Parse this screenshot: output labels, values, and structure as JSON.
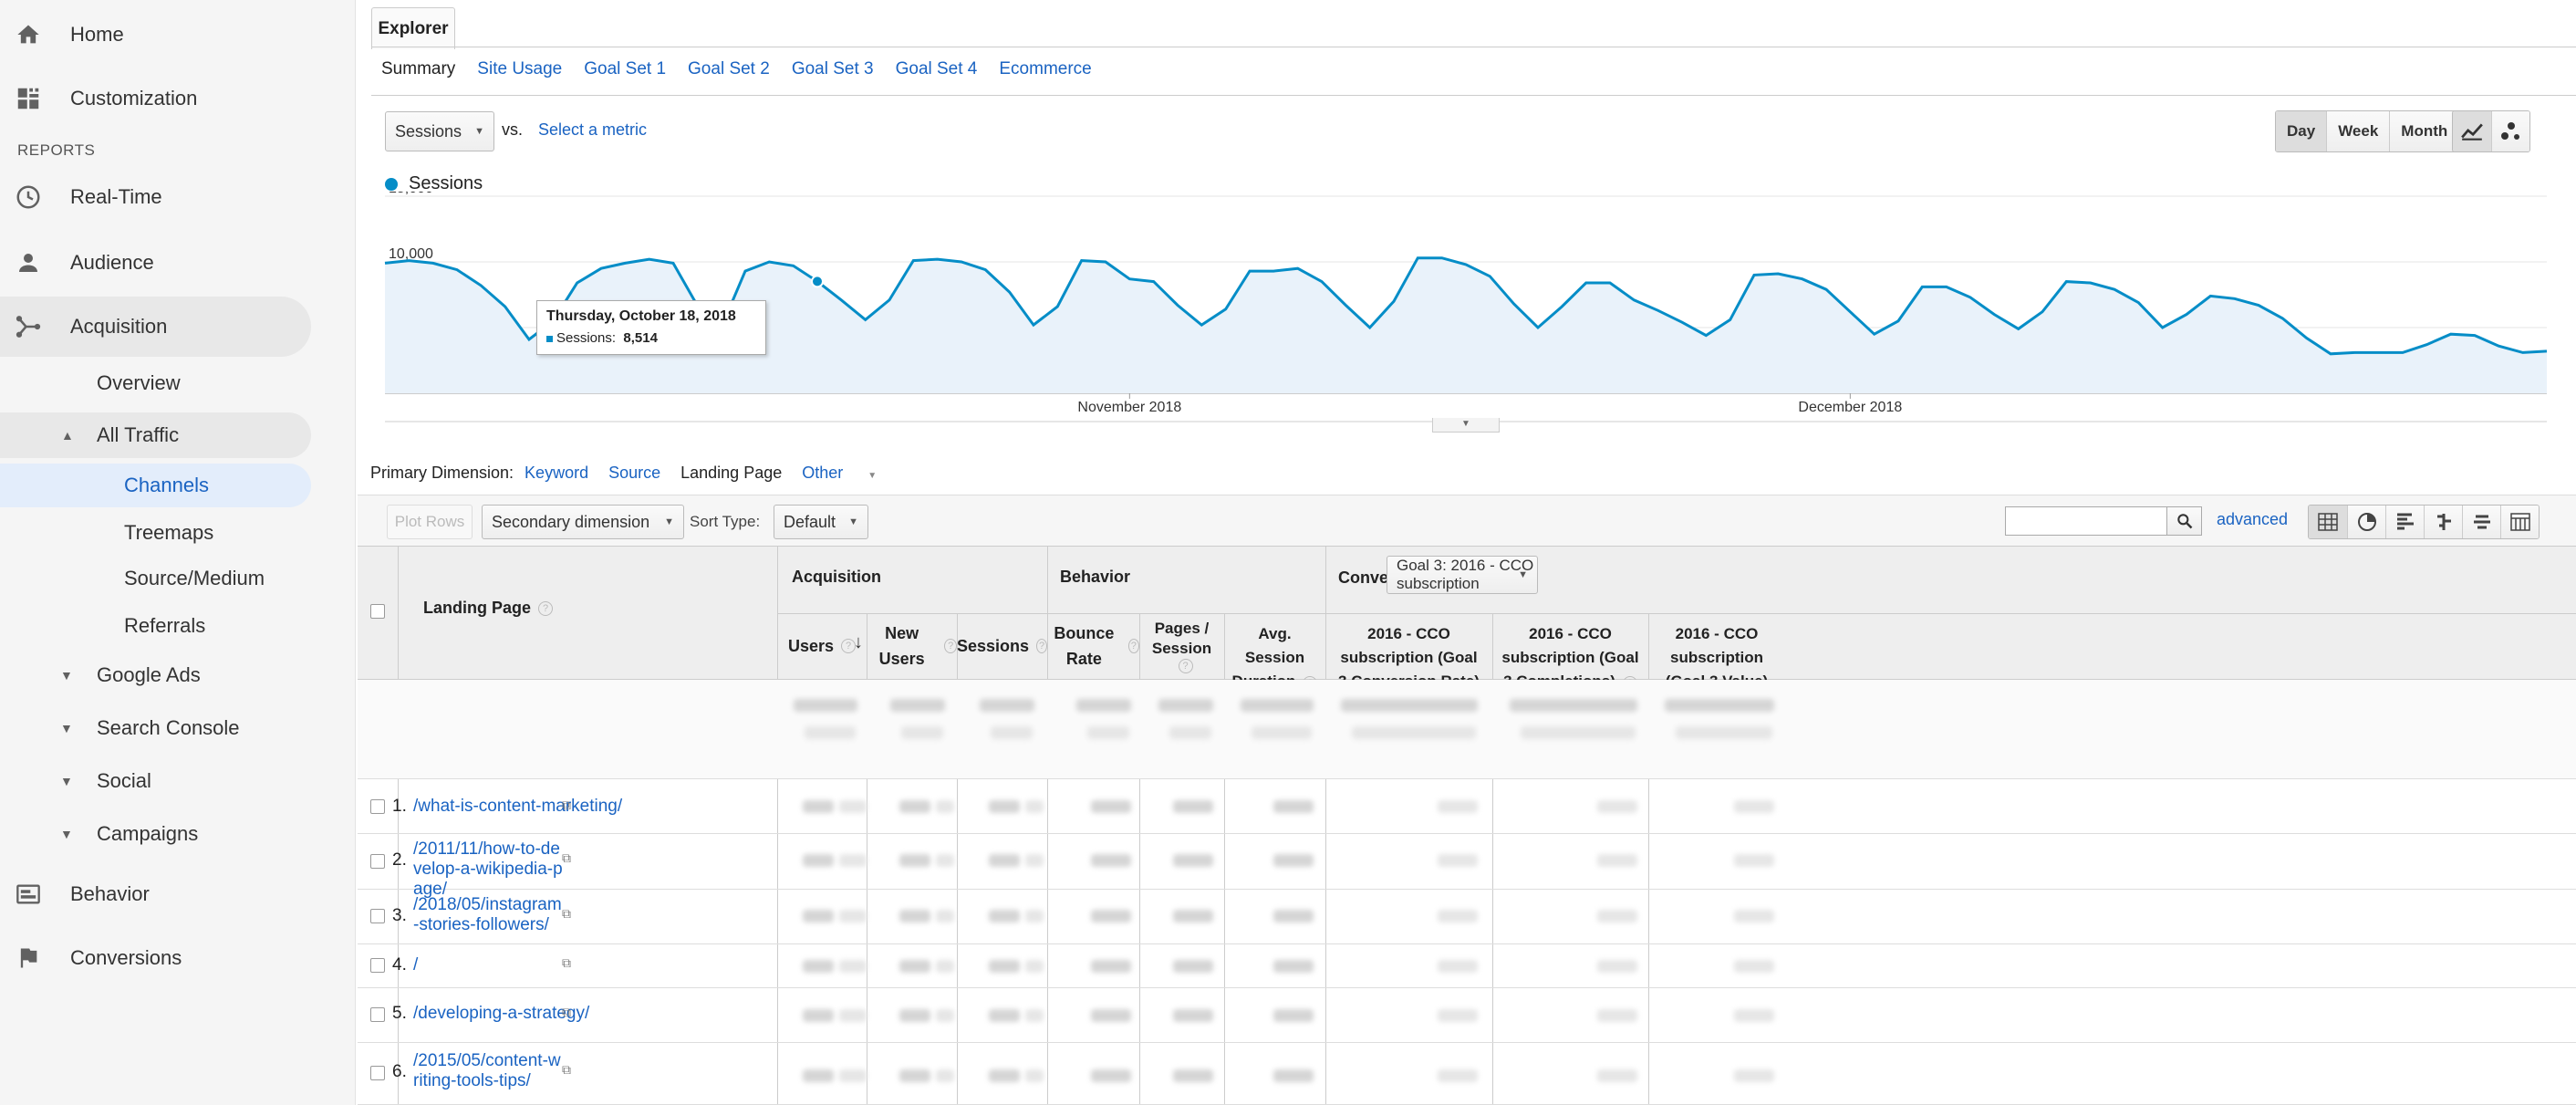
{
  "sidebar": {
    "home": "Home",
    "customization": "Customization",
    "reports_label": "REPORTS",
    "realtime": "Real-Time",
    "audience": "Audience",
    "acquisition": "Acquisition",
    "overview": "Overview",
    "all_traffic": "All Traffic",
    "channels": "Channels",
    "treemaps": "Treemaps",
    "source_medium": "Source/Medium",
    "referrals": "Referrals",
    "google_ads": "Google Ads",
    "search_console": "Search Console",
    "social": "Social",
    "campaigns": "Campaigns",
    "behavior": "Behavior",
    "conversions": "Conversions"
  },
  "explorer": {
    "tab": "Explorer",
    "subtabs": [
      "Summary",
      "Site Usage",
      "Goal Set 1",
      "Goal Set 2",
      "Goal Set 3",
      "Goal Set 4",
      "Ecommerce"
    ]
  },
  "controls": {
    "metric": "Sessions",
    "vs": "vs.",
    "select_metric": "Select a metric",
    "periods": [
      "Day",
      "Week",
      "Month"
    ],
    "active_period": "Day"
  },
  "chart_data": {
    "type": "area",
    "series": [
      {
        "name": "Sessions",
        "color": "#058dc7"
      }
    ],
    "y_ticks": [
      "15,000",
      "10,000",
      "5,000"
    ],
    "ylim": [
      0,
      15000
    ],
    "x_labels": [
      "November 2018",
      "December 2018"
    ],
    "x_start": "2018-10-01",
    "x_end": "2018-12-31",
    "values": [
      9900,
      10100,
      9900,
      9400,
      8200,
      6600,
      4100,
      5500,
      8400,
      9500,
      9900,
      10200,
      9900,
      6700,
      5000,
      9300,
      10000,
      9700,
      8514,
      7100,
      5600,
      7100,
      10100,
      10200,
      10000,
      9400,
      7700,
      5200,
      6600,
      10100,
      10000,
      8700,
      8500,
      6700,
      5200,
      6400,
      9300,
      9300,
      9500,
      8500,
      6700,
      5000,
      7000,
      10300,
      10300,
      9800,
      8900,
      6800,
      5000,
      6600,
      8400,
      8400,
      7100,
      6300,
      5400,
      4400,
      5600,
      9000,
      9100,
      8700,
      7900,
      6200,
      4500,
      5500,
      8100,
      8100,
      7300,
      6000,
      4900,
      6200,
      8500,
      8400,
      7900,
      6900,
      5000,
      6000,
      7400,
      7200,
      6700,
      5700,
      4200,
      3000,
      3100,
      3100,
      3100,
      3700,
      4500,
      4400,
      3600,
      3100,
      3200
    ]
  },
  "tooltip": {
    "date": "Thursday, October 18, 2018",
    "label": "Sessions:",
    "value": "8,514"
  },
  "dimensions": {
    "label": "Primary Dimension:",
    "options": [
      "Keyword",
      "Source",
      "Landing Page",
      "Other"
    ],
    "selected": "Landing Page"
  },
  "toolbar": {
    "plot_rows": "Plot Rows",
    "secondary_dimension": "Secondary dimension",
    "sort_type_label": "Sort Type:",
    "sort_type": "Default",
    "advanced": "advanced"
  },
  "table": {
    "landing_page_header": "Landing Page",
    "groups": {
      "acquisition": "Acquisition",
      "behavior": "Behavior",
      "conversions": "Conversions"
    },
    "goal_select": "Goal 3: 2016 - CCO subscription",
    "columns": {
      "users": "Users",
      "new_users": "New Users",
      "sessions": "Sessions",
      "bounce_rate": "Bounce Rate",
      "pages_session": "Pages / Session",
      "avg_duration": "Avg. Session Duration",
      "conv_rate": "2016 - CCO subscription (Goal 3 Conversion Rate)",
      "completions": "2016 - CCO subscription (Goal 3 Completions)",
      "value": "2016 - CCO subscription (Goal 3 Value)"
    },
    "rows": [
      {
        "n": "1.",
        "page": "/what-is-content-marketing/"
      },
      {
        "n": "2.",
        "page": "/2011/11/how-to-develop-a-wikipedia-page/"
      },
      {
        "n": "3.",
        "page": "/2018/05/instagram-stories-followers/"
      },
      {
        "n": "4.",
        "page": "/"
      },
      {
        "n": "5.",
        "page": "/developing-a-strategy/"
      },
      {
        "n": "6.",
        "page": "/2015/05/content-writing-tools-tips/"
      }
    ]
  }
}
